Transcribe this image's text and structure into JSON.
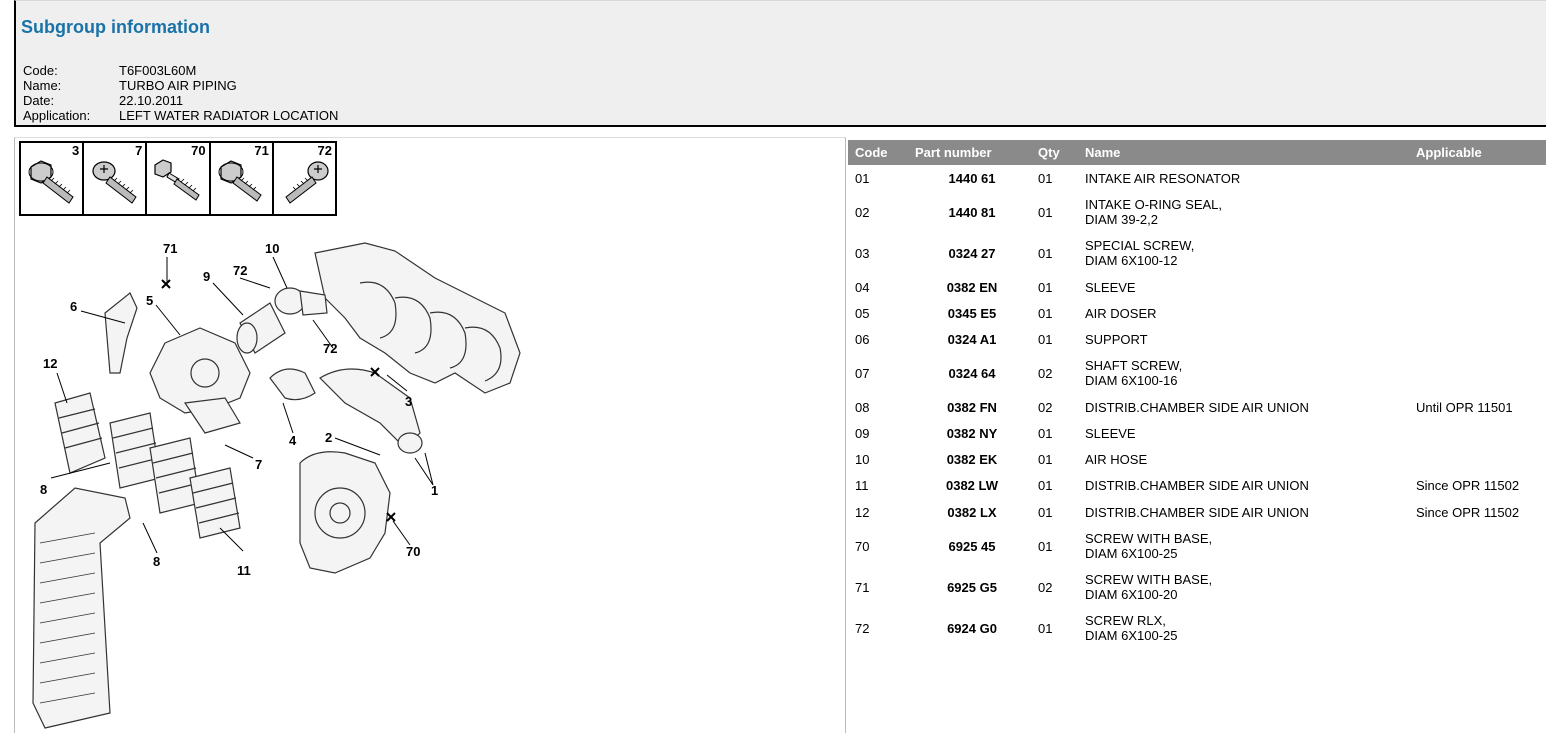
{
  "header": {
    "title": "Subgroup information",
    "fields": [
      {
        "label": "Code:",
        "value": "T6F003L60M"
      },
      {
        "label": "Name:",
        "value": "TURBO AIR PIPING"
      },
      {
        "label": "Date:",
        "value": "22.10.2011"
      },
      {
        "label": "Application:",
        "value": "LEFT WATER RADIATOR LOCATION"
      }
    ]
  },
  "screws": [
    "3",
    "7",
    "70",
    "71",
    "72"
  ],
  "diagram": {
    "callouts": [
      "71",
      "10",
      "72",
      "9",
      "6",
      "5",
      "72",
      "12",
      "3",
      "4",
      "2",
      "7",
      "1",
      "8",
      "8",
      "70",
      "11"
    ]
  },
  "table": {
    "headers": {
      "code": "Code",
      "part": "Part number",
      "qty": "Qty",
      "name": "Name",
      "applicable": "Applicable"
    },
    "rows": [
      {
        "code": "01",
        "part": "1440 61",
        "qty": "01",
        "name": "INTAKE AIR RESONATOR",
        "applicable": ""
      },
      {
        "code": "02",
        "part": "1440 81",
        "qty": "01",
        "name": "INTAKE O-RING SEAL,\nDIAM 39-2,2",
        "applicable": ""
      },
      {
        "code": "03",
        "part": "0324 27",
        "qty": "01",
        "name": "SPECIAL SCREW,\nDIAM 6X100-12",
        "applicable": ""
      },
      {
        "code": "04",
        "part": "0382 EN",
        "qty": "01",
        "name": "SLEEVE",
        "applicable": ""
      },
      {
        "code": "05",
        "part": "0345 E5",
        "qty": "01",
        "name": "AIR DOSER",
        "applicable": ""
      },
      {
        "code": "06",
        "part": "0324 A1",
        "qty": "01",
        "name": "SUPPORT",
        "applicable": ""
      },
      {
        "code": "07",
        "part": "0324 64",
        "qty": "02",
        "name": "SHAFT SCREW,\nDIAM 6X100-16",
        "applicable": ""
      },
      {
        "code": "08",
        "part": "0382 FN",
        "qty": "02",
        "name": "DISTRIB.CHAMBER SIDE AIR UNION",
        "applicable": "Until OPR 11501"
      },
      {
        "code": "09",
        "part": "0382 NY",
        "qty": "01",
        "name": "SLEEVE",
        "applicable": ""
      },
      {
        "code": "10",
        "part": "0382 EK",
        "qty": "01",
        "name": "AIR HOSE",
        "applicable": ""
      },
      {
        "code": "11",
        "part": "0382 LW",
        "qty": "01",
        "name": "DISTRIB.CHAMBER SIDE AIR UNION",
        "applicable": "Since OPR 11502"
      },
      {
        "code": "12",
        "part": "0382 LX",
        "qty": "01",
        "name": "DISTRIB.CHAMBER SIDE AIR UNION",
        "applicable": "Since OPR 11502"
      },
      {
        "code": "70",
        "part": "6925 45",
        "qty": "01",
        "name": "SCREW WITH BASE,\nDIAM 6X100-25",
        "applicable": ""
      },
      {
        "code": "71",
        "part": "6925 G5",
        "qty": "02",
        "name": "SCREW WITH BASE,\nDIAM 6X100-20",
        "applicable": ""
      },
      {
        "code": "72",
        "part": "6924 G0",
        "qty": "01",
        "name": "SCREW RLX,\nDIAM 6X100-25",
        "applicable": ""
      }
    ]
  }
}
